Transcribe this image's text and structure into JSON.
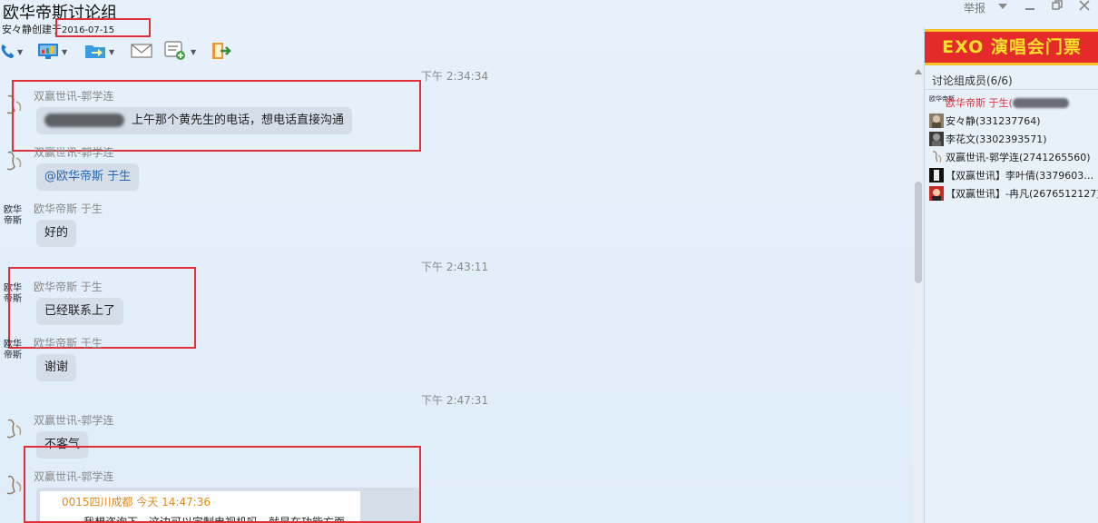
{
  "header": {
    "title": "欧华帝斯讨论组",
    "creator": "安々静创建于",
    "created_date": "2016-07-15",
    "report_label": "举报"
  },
  "toolbar": {
    "items": [
      {
        "icon": "phone-icon"
      },
      {
        "icon": "screen-share-icon"
      },
      {
        "icon": "file-transfer-icon"
      },
      {
        "icon": "email-icon"
      },
      {
        "icon": "add-app-icon"
      },
      {
        "icon": "exit-icon"
      }
    ]
  },
  "chat": {
    "timestamps": [
      "下午 2:34:34",
      "下午 2:43:11",
      "下午 2:47:31"
    ],
    "messages": [
      {
        "sender": "双赢世讯-郭学连",
        "text": "上午那个黄先生的电话，想电话直接沟通",
        "redacted_prefix": true
      },
      {
        "sender": "双赢世讯-郭学连",
        "text": "@欧华帝斯 于生"
      },
      {
        "sender": "欧华帝斯 于生",
        "text": "好的"
      },
      {
        "sender": "欧华帝斯 于生",
        "text": "已经联系上了"
      },
      {
        "sender": "欧华帝斯 于生",
        "text": "谢谢"
      },
      {
        "sender": "双赢世讯-郭学连",
        "text": "不客气"
      },
      {
        "sender": "双赢世讯-郭学连",
        "quote_header": "0015四川成都  今天 14:47:36",
        "quote_text": "我想咨询下，这边可以定制电视机吗，就是在功能方面"
      }
    ]
  },
  "avatar_text": {
    "owner": "欧华帝斯"
  },
  "right_panel": {
    "ad_text": "EXO 演唱会门票",
    "members_title": "讨论组成员(6/6)",
    "members": [
      {
        "name": "欧华帝斯 于生(",
        "owner": true
      },
      {
        "name": "安々静(331237764)"
      },
      {
        "name": "李花文(3302393571)"
      },
      {
        "name": "双赢世讯-郭学连(2741265560)"
      },
      {
        "name": "【双赢世讯】李叶倩(3379603…"
      },
      {
        "name": "【双赢世讯】-冉凡(2676512127)"
      }
    ]
  },
  "colors": {
    "accent_red": "#e0303a",
    "bubble": "#d4dde8",
    "background": "#e6f1fb"
  }
}
